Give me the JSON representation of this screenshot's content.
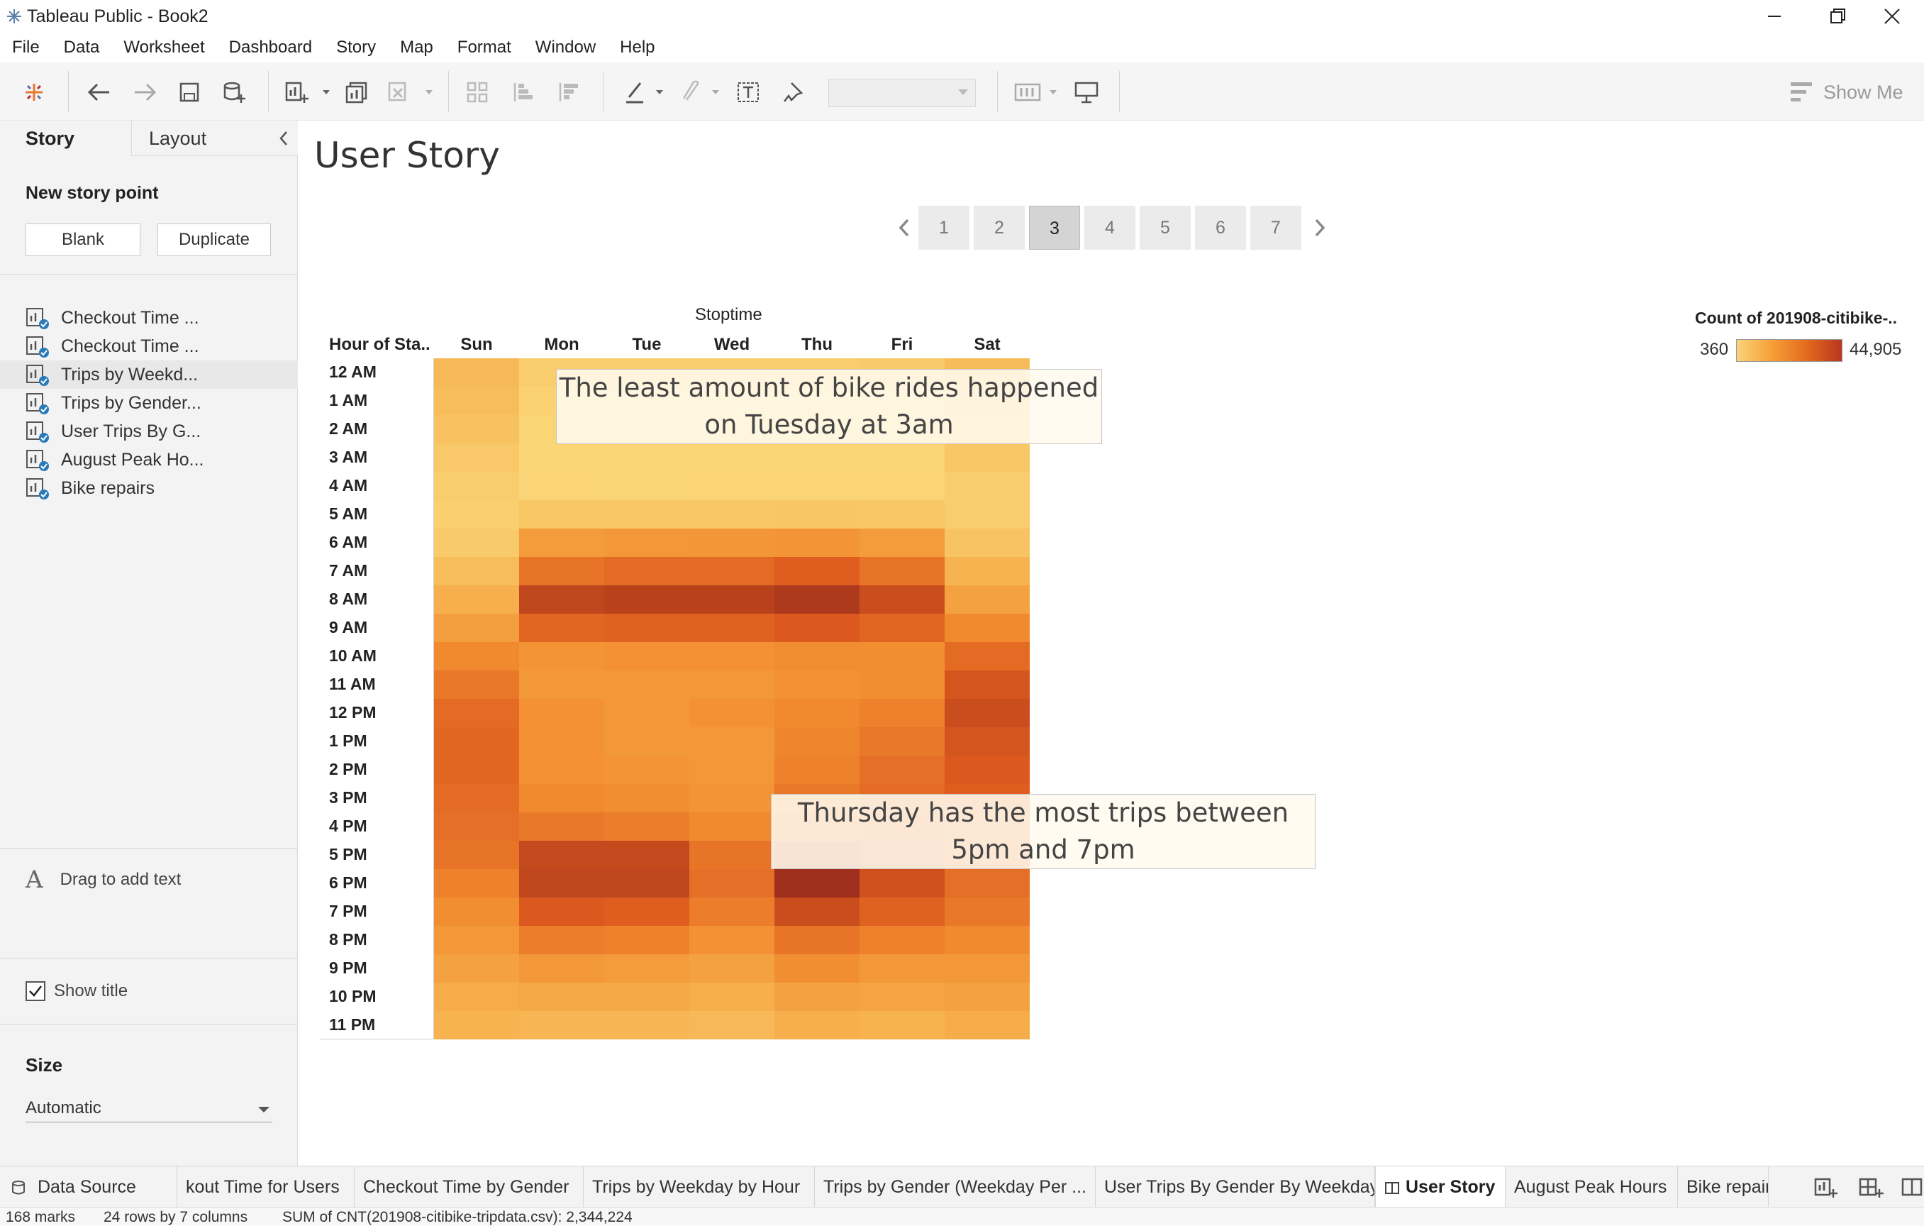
{
  "window": {
    "title": "Tableau Public - Book2"
  },
  "menu": [
    "File",
    "Data",
    "Worksheet",
    "Dashboard",
    "Story",
    "Map",
    "Format",
    "Window",
    "Help"
  ],
  "toolbar": {
    "show_me": "Show Me",
    "icons": [
      "tableau-logo-icon",
      "undo-icon",
      "redo-icon",
      "save-icon",
      "new-data-source-icon",
      "new-worksheet-icon",
      "duplicate-sheet-icon",
      "clear-sheet-icon",
      "group-icon",
      "sort-ascending-icon",
      "sort-descending-icon",
      "highlight-icon",
      "annotate-icon",
      "text-label-icon",
      "pin-icon",
      "fit-select",
      "show-cards-icon",
      "presentation-icon"
    ]
  },
  "sidebar": {
    "tabs": {
      "story": "Story",
      "layout": "Layout"
    },
    "new_story_point": "New story point",
    "blank_label": "Blank",
    "duplicate_label": "Duplicate",
    "sheets": [
      "Checkout Time ...",
      "Checkout Time ...",
      "Trips by Weekd...",
      "Trips by Gender...",
      "User Trips By G...",
      "August Peak Ho...",
      "Bike repairs"
    ],
    "active_sheet_index": 2,
    "drag_text": "Drag to add text",
    "drag_text_icon": "A",
    "show_title_label": "Show title",
    "show_title_checked": true,
    "size_title": "Size",
    "size_value": "Automatic"
  },
  "story": {
    "title": "User Story",
    "points": [
      "1",
      "2",
      "3",
      "4",
      "5",
      "6",
      "7"
    ],
    "active_point": 3
  },
  "chart_data": {
    "type": "heatmap",
    "column_header": "Stoptime",
    "row_header": "Hour of Sta..",
    "x": [
      "Sun",
      "Mon",
      "Tue",
      "Wed",
      "Thu",
      "Fri",
      "Sat"
    ],
    "y": [
      "12 AM",
      "1 AM",
      "2 AM",
      "3 AM",
      "4 AM",
      "5 AM",
      "6 AM",
      "7 AM",
      "8 AM",
      "9 AM",
      "10 AM",
      "11 AM",
      "12 PM",
      "1 PM",
      "2 PM",
      "3 PM",
      "4 PM",
      "5 PM",
      "6 PM",
      "7 PM",
      "8 PM",
      "9 PM",
      "10 PM",
      "11 PM"
    ],
    "values": [
      [
        9000,
        3000,
        3000,
        3000,
        3500,
        4000,
        8500
      ],
      [
        8000,
        1500,
        1500,
        1500,
        1800,
        2000,
        8000
      ],
      [
        6500,
        800,
        700,
        800,
        900,
        1200,
        6500
      ],
      [
        4500,
        500,
        360,
        500,
        500,
        700,
        5000
      ],
      [
        3000,
        900,
        800,
        900,
        900,
        1000,
        3000
      ],
      [
        2500,
        5000,
        5000,
        5000,
        5200,
        5000,
        3000
      ],
      [
        4000,
        18000,
        19000,
        19500,
        20000,
        18000,
        6000
      ],
      [
        8000,
        28000,
        30000,
        30000,
        33000,
        28000,
        11000
      ],
      [
        12000,
        39000,
        40000,
        40000,
        42000,
        37000,
        16000
      ],
      [
        17000,
        31000,
        32000,
        32000,
        34000,
        31000,
        23000
      ],
      [
        23000,
        20000,
        21000,
        21000,
        22000,
        22000,
        30000
      ],
      [
        27000,
        19000,
        19000,
        19000,
        21000,
        22000,
        35000
      ],
      [
        30000,
        21000,
        19000,
        21000,
        23000,
        25000,
        37000
      ],
      [
        31000,
        21000,
        19000,
        19000,
        24000,
        27000,
        35000
      ],
      [
        31000,
        21000,
        20000,
        19000,
        25000,
        29000,
        34000
      ],
      [
        30000,
        23000,
        22000,
        20000,
        27000,
        30000,
        33000
      ],
      [
        29000,
        27000,
        26000,
        23000,
        30000,
        33000,
        32000
      ],
      [
        28000,
        38000,
        38000,
        28000,
        40000,
        35000,
        31000
      ],
      [
        25000,
        39000,
        39000,
        29000,
        44905,
        36000,
        29000
      ],
      [
        22000,
        34000,
        33000,
        26000,
        37000,
        32000,
        27000
      ],
      [
        19000,
        26000,
        25000,
        21000,
        28000,
        25000,
        23000
      ],
      [
        16000,
        19000,
        18000,
        16000,
        22000,
        19000,
        19000
      ],
      [
        13000,
        14000,
        14000,
        12000,
        16000,
        15000,
        16000
      ],
      [
        11000,
        10000,
        10000,
        9000,
        12000,
        11000,
        13000
      ]
    ],
    "color_min": 360,
    "color_max": 44905,
    "legend_title": "Count of 201908-citibike-..",
    "legend_min_label": "360",
    "legend_max_label": "44,905",
    "annotations": [
      "The least amount of bike rides happened on Tuesday at 3am",
      "Thursday has the most trips between 5pm and 7pm"
    ]
  },
  "bottom_tabs": {
    "data_source": "Data Source",
    "sheets": [
      "kout Time for Users",
      "Checkout Time by Gender",
      "Trips by Weekday by Hour",
      "Trips by Gender (Weekday Per ...",
      "User Trips By Gender By Weekday",
      "User Story",
      "August Peak Hours",
      "Bike repairs"
    ],
    "active_index": 5
  },
  "status": {
    "marks": "168 marks",
    "rows_cols": "24 rows by 7 columns",
    "sum": "SUM of CNT(201908-citibike-tripdata.csv): 2,344,224"
  },
  "colors": {
    "accent_blue": "#1f77b4",
    "heat_low": "#fad37a",
    "heat_high": "#9e2f1c"
  }
}
